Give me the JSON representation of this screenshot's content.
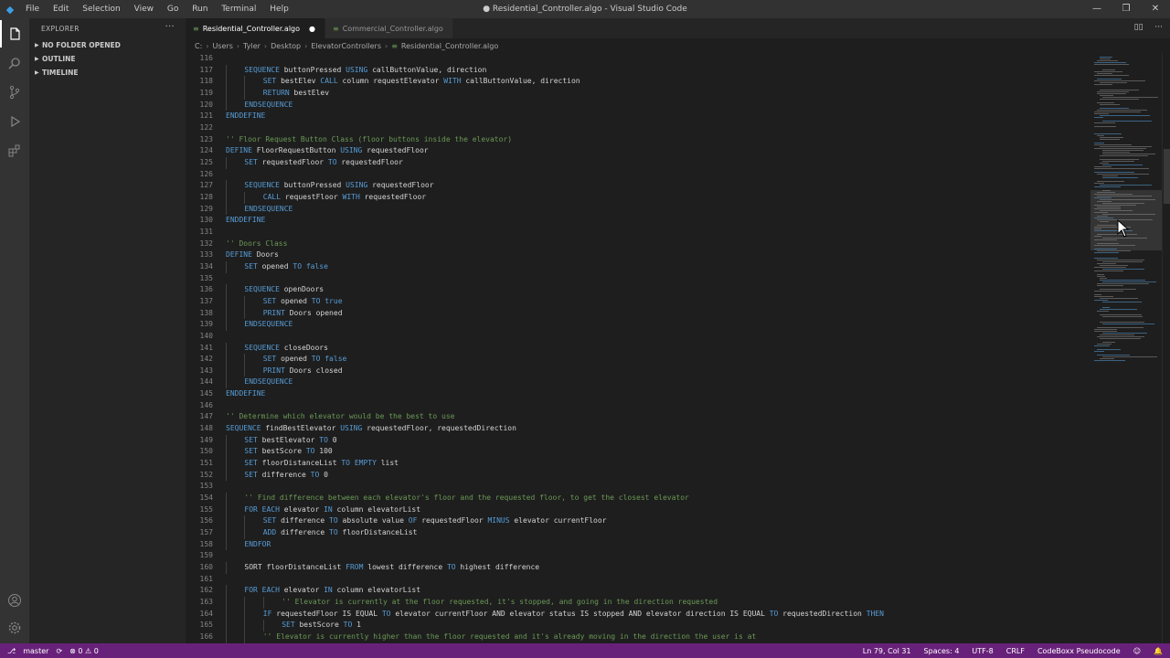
{
  "titlebar": {
    "menu": [
      "File",
      "Edit",
      "Selection",
      "View",
      "Go",
      "Run",
      "Terminal",
      "Help"
    ],
    "title": "● Residential_Controller.algo - Visual Studio Code",
    "controls": [
      "—",
      "❐",
      "✕"
    ]
  },
  "sidebar": {
    "header": "EXPLORER",
    "more": "···",
    "sections": [
      "NO FOLDER OPENED",
      "OUTLINE",
      "TIMELINE"
    ]
  },
  "tabs": [
    {
      "label": "Residential_Controller.algo",
      "modified": "●"
    },
    {
      "label": "Commercial_Controller.algo"
    }
  ],
  "breadcrumb": [
    "C:",
    "Users",
    "Tyler",
    "Desktop",
    "ElevatorControllers",
    "Residential_Controller.algo"
  ],
  "editor": {
    "lines": [
      {
        "n": "116",
        "indent": 0,
        "t": []
      },
      {
        "n": "117",
        "indent": 1,
        "t": [
          [
            "k",
            "SEQUENCE"
          ],
          [
            "p",
            " buttonPressed "
          ],
          [
            "k",
            "USING"
          ],
          [
            "p",
            " callButtonValue, direction"
          ]
        ]
      },
      {
        "n": "118",
        "indent": 2,
        "t": [
          [
            "k",
            "SET"
          ],
          [
            "p",
            " bestElev "
          ],
          [
            "k",
            "CALL"
          ],
          [
            "p",
            " column requestElevator "
          ],
          [
            "k",
            "WITH"
          ],
          [
            "p",
            " callButtonValue, direction"
          ]
        ]
      },
      {
        "n": "119",
        "indent": 2,
        "t": [
          [
            "k",
            "RETURN"
          ],
          [
            "p",
            " bestElev"
          ]
        ]
      },
      {
        "n": "120",
        "indent": 1,
        "t": [
          [
            "k",
            "ENDSEQUENCE"
          ]
        ]
      },
      {
        "n": "121",
        "indent": 0,
        "t": [
          [
            "k",
            "ENDDEFINE"
          ]
        ]
      },
      {
        "n": "122",
        "indent": 0,
        "t": []
      },
      {
        "n": "123",
        "indent": 0,
        "t": [
          [
            "c",
            "'' Floor Request Button Class (floor buttons inside the elevator)"
          ]
        ]
      },
      {
        "n": "124",
        "indent": 0,
        "t": [
          [
            "k",
            "DEFINE"
          ],
          [
            "p",
            " FloorRequestButton "
          ],
          [
            "k",
            "USING"
          ],
          [
            "p",
            " requestedFloor"
          ]
        ]
      },
      {
        "n": "125",
        "indent": 1,
        "t": [
          [
            "k",
            "SET"
          ],
          [
            "p",
            " requestedFloor "
          ],
          [
            "k",
            "TO"
          ],
          [
            "p",
            " requestedFloor"
          ]
        ]
      },
      {
        "n": "126",
        "indent": 0,
        "t": []
      },
      {
        "n": "127",
        "indent": 1,
        "t": [
          [
            "k",
            "SEQUENCE"
          ],
          [
            "p",
            " buttonPressed "
          ],
          [
            "k",
            "USING"
          ],
          [
            "p",
            " requestedFloor"
          ]
        ]
      },
      {
        "n": "128",
        "indent": 2,
        "t": [
          [
            "k",
            "CALL"
          ],
          [
            "p",
            " requestFloor "
          ],
          [
            "k",
            "WITH"
          ],
          [
            "p",
            " requestedFloor"
          ]
        ]
      },
      {
        "n": "129",
        "indent": 1,
        "t": [
          [
            "k",
            "ENDSEQUENCE"
          ]
        ]
      },
      {
        "n": "130",
        "indent": 0,
        "t": [
          [
            "k",
            "ENDDEFINE"
          ]
        ]
      },
      {
        "n": "131",
        "indent": 0,
        "t": []
      },
      {
        "n": "132",
        "indent": 0,
        "t": [
          [
            "c",
            "'' Doors Class"
          ]
        ]
      },
      {
        "n": "133",
        "indent": 0,
        "t": [
          [
            "k",
            "DEFINE"
          ],
          [
            "p",
            " Doors"
          ]
        ]
      },
      {
        "n": "134",
        "indent": 1,
        "t": [
          [
            "k",
            "SET"
          ],
          [
            "p",
            " opened "
          ],
          [
            "k",
            "TO"
          ],
          [
            "k",
            " false"
          ]
        ]
      },
      {
        "n": "135",
        "indent": 0,
        "t": []
      },
      {
        "n": "136",
        "indent": 1,
        "t": [
          [
            "k",
            "SEQUENCE"
          ],
          [
            "p",
            " openDoors"
          ]
        ]
      },
      {
        "n": "137",
        "indent": 2,
        "t": [
          [
            "k",
            "SET"
          ],
          [
            "p",
            " opened "
          ],
          [
            "k",
            "TO"
          ],
          [
            "k",
            " true"
          ]
        ]
      },
      {
        "n": "138",
        "indent": 2,
        "t": [
          [
            "k",
            "PRINT"
          ],
          [
            "p",
            " Doors opened"
          ]
        ]
      },
      {
        "n": "139",
        "indent": 1,
        "t": [
          [
            "k",
            "ENDSEQUENCE"
          ]
        ]
      },
      {
        "n": "140",
        "indent": 0,
        "t": []
      },
      {
        "n": "141",
        "indent": 1,
        "t": [
          [
            "k",
            "SEQUENCE"
          ],
          [
            "p",
            " closeDoors"
          ]
        ]
      },
      {
        "n": "142",
        "indent": 2,
        "t": [
          [
            "k",
            "SET"
          ],
          [
            "p",
            " opened "
          ],
          [
            "k",
            "TO"
          ],
          [
            "k",
            " false"
          ]
        ]
      },
      {
        "n": "143",
        "indent": 2,
        "t": [
          [
            "k",
            "PRINT"
          ],
          [
            "p",
            " Doors closed"
          ]
        ]
      },
      {
        "n": "144",
        "indent": 1,
        "t": [
          [
            "k",
            "ENDSEQUENCE"
          ]
        ]
      },
      {
        "n": "145",
        "indent": 0,
        "t": [
          [
            "k",
            "ENDDEFINE"
          ]
        ]
      },
      {
        "n": "146",
        "indent": 0,
        "t": []
      },
      {
        "n": "147",
        "indent": 0,
        "t": [
          [
            "c",
            "'' Determine which elevator would be the best to use"
          ]
        ]
      },
      {
        "n": "148",
        "indent": 0,
        "t": [
          [
            "k",
            "SEQUENCE"
          ],
          [
            "p",
            " findBestElevator "
          ],
          [
            "k",
            "USING"
          ],
          [
            "p",
            " requestedFloor, requestedDirection"
          ]
        ]
      },
      {
        "n": "149",
        "indent": 1,
        "t": [
          [
            "k",
            "SET"
          ],
          [
            "p",
            " bestElevator "
          ],
          [
            "k",
            "TO"
          ],
          [
            "p",
            " 0"
          ]
        ]
      },
      {
        "n": "150",
        "indent": 1,
        "t": [
          [
            "k",
            "SET"
          ],
          [
            "p",
            " bestScore "
          ],
          [
            "k",
            "TO"
          ],
          [
            "p",
            " 100"
          ]
        ]
      },
      {
        "n": "151",
        "indent": 1,
        "t": [
          [
            "k",
            "SET"
          ],
          [
            "p",
            " floorDistanceList "
          ],
          [
            "k",
            "TO"
          ],
          [
            "k",
            " EMPTY"
          ],
          [
            "p",
            " list"
          ]
        ]
      },
      {
        "n": "152",
        "indent": 1,
        "t": [
          [
            "k",
            "SET"
          ],
          [
            "p",
            " difference "
          ],
          [
            "k",
            "TO"
          ],
          [
            "p",
            " 0"
          ]
        ]
      },
      {
        "n": "153",
        "indent": 0,
        "t": []
      },
      {
        "n": "154",
        "indent": 1,
        "t": [
          [
            "c",
            "'' Find difference between each elevator's floor and the requested floor, to get the closest elevator"
          ]
        ]
      },
      {
        "n": "155",
        "indent": 1,
        "t": [
          [
            "k",
            "FOR EACH"
          ],
          [
            "p",
            " elevator "
          ],
          [
            "k",
            "IN"
          ],
          [
            "p",
            " column elevatorList"
          ]
        ]
      },
      {
        "n": "156",
        "indent": 2,
        "t": [
          [
            "k",
            "SET"
          ],
          [
            "p",
            " difference "
          ],
          [
            "k",
            "TO"
          ],
          [
            "p",
            " absolute value "
          ],
          [
            "k",
            "OF"
          ],
          [
            "p",
            " requestedFloor "
          ],
          [
            "k",
            "MINUS"
          ],
          [
            "p",
            " elevator currentFloor"
          ]
        ]
      },
      {
        "n": "157",
        "indent": 2,
        "t": [
          [
            "k",
            "ADD"
          ],
          [
            "p",
            " difference "
          ],
          [
            "k",
            "TO"
          ],
          [
            "p",
            " floorDistanceList"
          ]
        ]
      },
      {
        "n": "158",
        "indent": 1,
        "t": [
          [
            "k",
            "ENDFOR"
          ]
        ]
      },
      {
        "n": "159",
        "indent": 0,
        "t": []
      },
      {
        "n": "160",
        "indent": 1,
        "t": [
          [
            "p",
            "SORT floorDistanceList "
          ],
          [
            "k",
            "FROM"
          ],
          [
            "p",
            " lowest difference "
          ],
          [
            "k",
            "TO"
          ],
          [
            "p",
            " highest difference"
          ]
        ]
      },
      {
        "n": "161",
        "indent": 0,
        "t": []
      },
      {
        "n": "162",
        "indent": 1,
        "t": [
          [
            "k",
            "FOR EACH"
          ],
          [
            "p",
            " elevator "
          ],
          [
            "k",
            "IN"
          ],
          [
            "p",
            " column elevatorList"
          ]
        ]
      },
      {
        "n": "163",
        "indent": 3,
        "t": [
          [
            "c",
            "'' Elevator is currently at the floor requested, it's stopped, and going in the direction requested"
          ]
        ]
      },
      {
        "n": "164",
        "indent": 2,
        "t": [
          [
            "k",
            "IF"
          ],
          [
            "p",
            " requestedFloor IS EQUAL "
          ],
          [
            "k",
            "TO"
          ],
          [
            "p",
            " elevator currentFloor AND elevator status IS stopped AND elevator direction IS EQUAL "
          ],
          [
            "k",
            "TO"
          ],
          [
            "p",
            " requestedDirection "
          ],
          [
            "k",
            "THEN"
          ]
        ]
      },
      {
        "n": "165",
        "indent": 3,
        "t": [
          [
            "k",
            "SET"
          ],
          [
            "p",
            " bestScore "
          ],
          [
            "k",
            "TO"
          ],
          [
            "p",
            " 1"
          ]
        ]
      },
      {
        "n": "166",
        "indent": 2,
        "t": [
          [
            "c",
            "'' Elevator is currently higher than the floor requested and it's already moving in the direction the user is at"
          ]
        ]
      }
    ]
  },
  "statusbar": {
    "branch": "master",
    "sync": "⟳",
    "problems": "⊗ 0 ⚠ 0",
    "position": "Ln 79, Col 31",
    "spaces": "Spaces: 4",
    "encoding": "UTF-8",
    "eol": "CRLF",
    "language": "CodeBoxx Pseudocode",
    "feedback": "☺",
    "bell": "🔔"
  },
  "icons": {
    "explorer": "files-icon",
    "search": "search-icon",
    "scm": "source-control-icon",
    "run": "run-debug-icon",
    "extensions": "extensions-icon",
    "accounts": "account-icon",
    "manage": "gear-icon"
  },
  "colors": {
    "statusbar": "#68217a",
    "keyword": "#569cd6",
    "comment": "#6a9955",
    "text": "#d4d4d4"
  }
}
